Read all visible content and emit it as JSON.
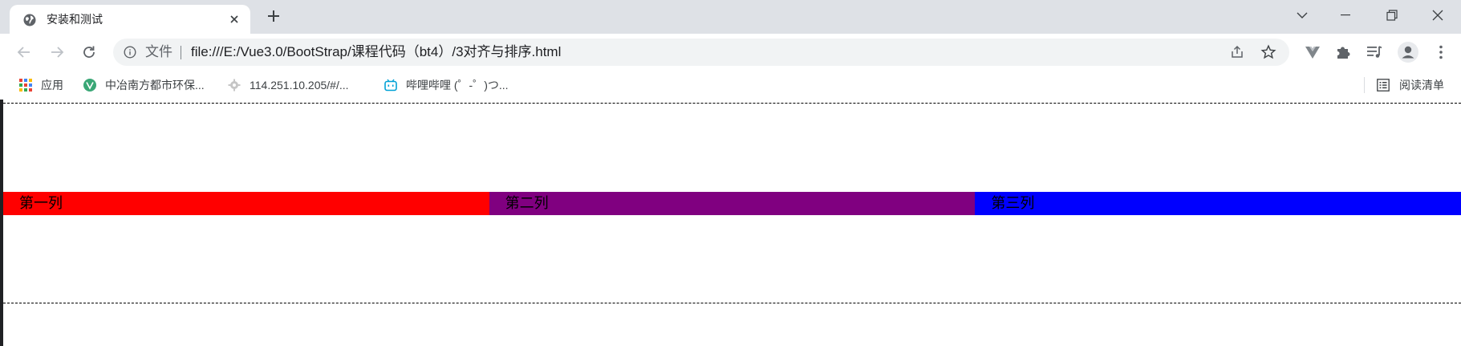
{
  "tab": {
    "title": "安装和测试",
    "favicon": "globe-icon"
  },
  "omnibox": {
    "scheme_label": "文件",
    "url": "file:///E:/Vue3.0/BootStrap/课程代码（bt4）/3对齐与排序.html"
  },
  "bookmarks": {
    "items": [
      {
        "label": "应用",
        "icon": "apps-grid-icon"
      },
      {
        "label": "中冶南方都市环保...",
        "icon": "vue-logo-icon"
      },
      {
        "label": "114.251.10.205/#/...",
        "icon": "gear-icon"
      },
      {
        "label": "哔哩哔哩 (゜-゜)つ...",
        "icon": "bilibili-icon"
      }
    ],
    "reading_list": "阅读清单"
  },
  "page": {
    "columns": [
      {
        "label": "第一列",
        "color": "#ff0000"
      },
      {
        "label": "第二列",
        "color": "#800080"
      },
      {
        "label": "第三列",
        "color": "#0000ff"
      }
    ]
  }
}
